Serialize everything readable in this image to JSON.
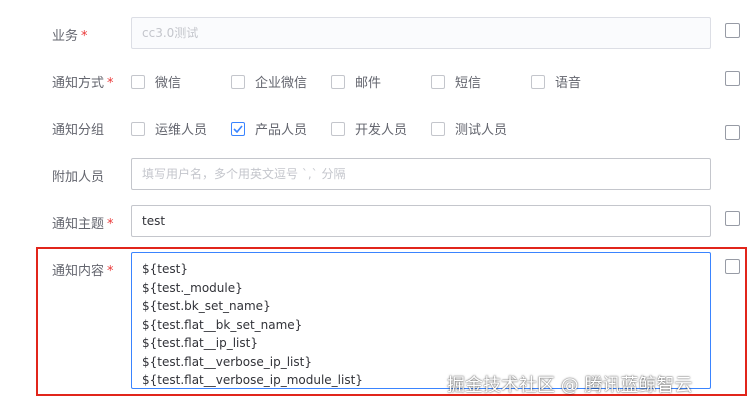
{
  "form": {
    "business": {
      "label": "业务",
      "value": "cc3.0测试"
    },
    "notify_method": {
      "label": "通知方式",
      "options": [
        {
          "label": "微信",
          "checked": false
        },
        {
          "label": "企业微信",
          "checked": false
        },
        {
          "label": "邮件",
          "checked": false
        },
        {
          "label": "短信",
          "checked": false
        },
        {
          "label": "语音",
          "checked": false
        }
      ]
    },
    "notify_group": {
      "label": "通知分组",
      "options": [
        {
          "label": "运维人员",
          "checked": false
        },
        {
          "label": "产品人员",
          "checked": true
        },
        {
          "label": "开发人员",
          "checked": false
        },
        {
          "label": "测试人员",
          "checked": false
        }
      ]
    },
    "extra_users": {
      "label": "附加人员",
      "placeholder": "填写用户名，多个用英文逗号 `,` 分隔"
    },
    "subject": {
      "label": "通知主题",
      "value": "test"
    },
    "content": {
      "label": "通知内容",
      "lines": [
        "${test}",
        "${test._module}",
        "${test.bk_set_name}",
        "${test.flat__bk_set_name}",
        "${test.flat__ip_list}",
        "${test.flat__verbose_ip_list}",
        "${test.flat__verbose_ip_module_list}"
      ]
    },
    "required_mark": "*"
  },
  "watermark": "掘金技术社区 @ 腾讯蓝鲸智云",
  "colors": {
    "accent": "#3a84ff",
    "required": "#ea3636",
    "highlight": "#e1251b"
  }
}
